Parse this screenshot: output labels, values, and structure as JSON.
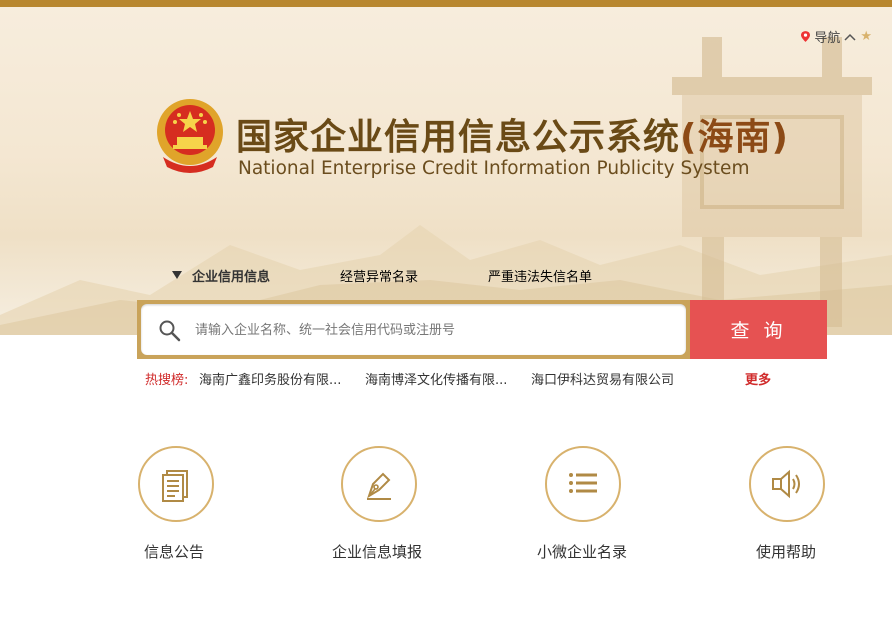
{
  "header": {
    "nav_label": "导航",
    "nav_caret": "^",
    "title_cn": "国家企业信用信息公示系统",
    "title_region": "(海南)",
    "title_en": "National Enterprise Credit Information Publicity System"
  },
  "tabs": [
    {
      "label": "企业信用信息",
      "active": true
    },
    {
      "label": "经营异常名录",
      "active": false
    },
    {
      "label": "严重违法失信名单",
      "active": false
    }
  ],
  "search": {
    "placeholder": "请输入企业名称、统一社会信用代码或注册号",
    "button_label": "查询"
  },
  "hot": {
    "label": "热搜榜:",
    "items": [
      "海南广鑫印务股份有限...",
      "海南博泽文化传播有限...",
      "海口伊科达贸易有限公司"
    ],
    "more_label": "更多"
  },
  "features": [
    {
      "label": "信息公告",
      "icon": "document-icon"
    },
    {
      "label": "企业信息填报",
      "icon": "pen-icon"
    },
    {
      "label": "小微企业名录",
      "icon": "list-icon"
    },
    {
      "label": "使用帮助",
      "icon": "speaker-icon"
    }
  ],
  "colors": {
    "gold": "#d8b26d",
    "accent_red": "#e65252",
    "brown": "#6a4a16"
  }
}
